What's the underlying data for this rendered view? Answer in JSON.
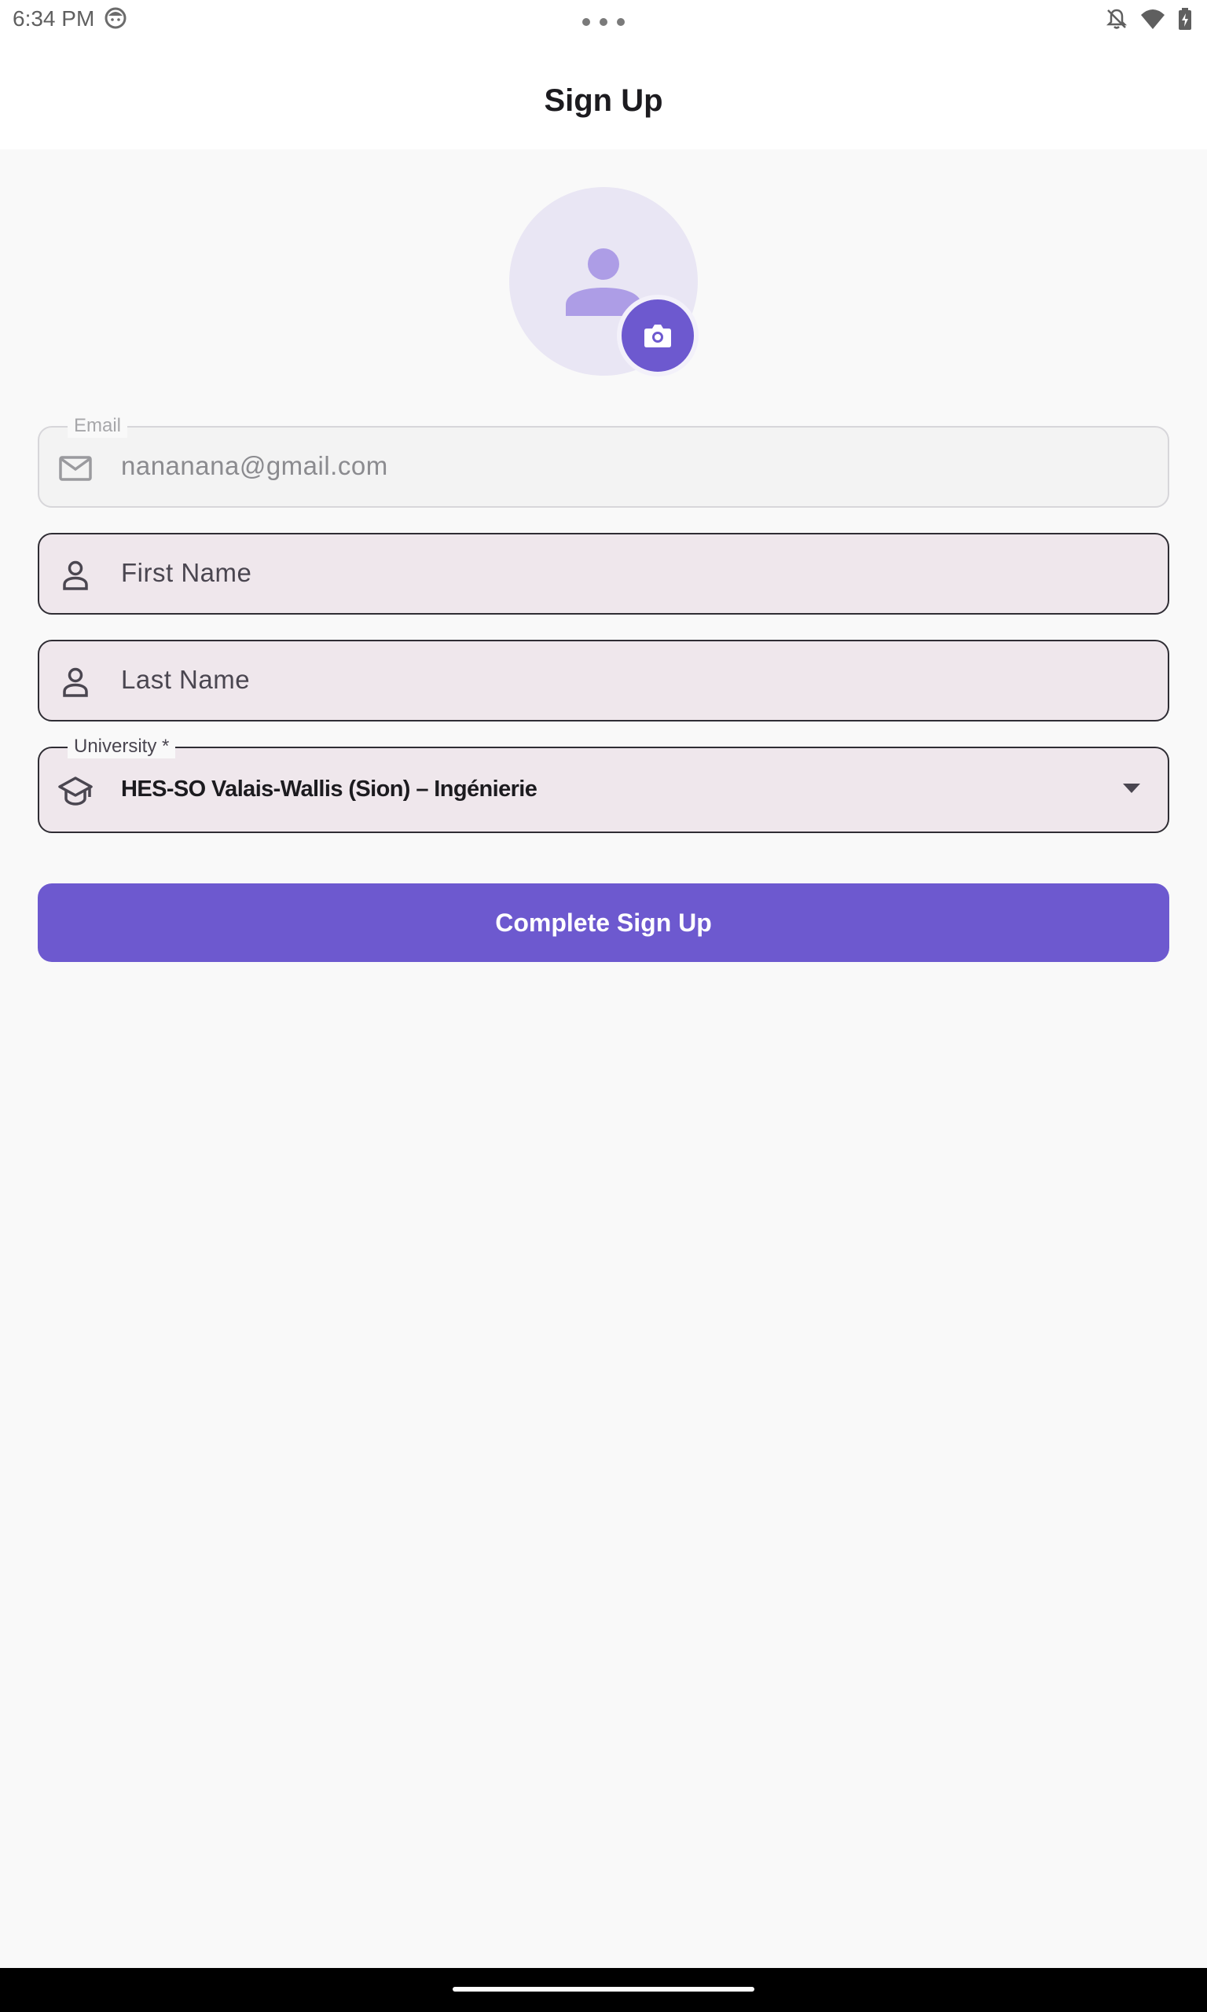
{
  "status_bar": {
    "time": "6:34 PM"
  },
  "app_bar": {
    "title": "Sign Up"
  },
  "form": {
    "email": {
      "label": "Email",
      "value": "nananana@gmail.com",
      "icon": "mail-icon"
    },
    "first_name": {
      "placeholder": "First Name",
      "icon": "person-icon"
    },
    "last_name": {
      "placeholder": "Last Name",
      "icon": "person-icon"
    },
    "university": {
      "label": "University *",
      "value": "HES-SO Valais-Wallis (Sion) – Ingénierie",
      "icon": "school-icon"
    },
    "submit_label": "Complete Sign Up"
  },
  "colors": {
    "accent": "#6d59cf",
    "field_fill": "#efe7ec",
    "avatar_bg": "#e9e6f4"
  }
}
